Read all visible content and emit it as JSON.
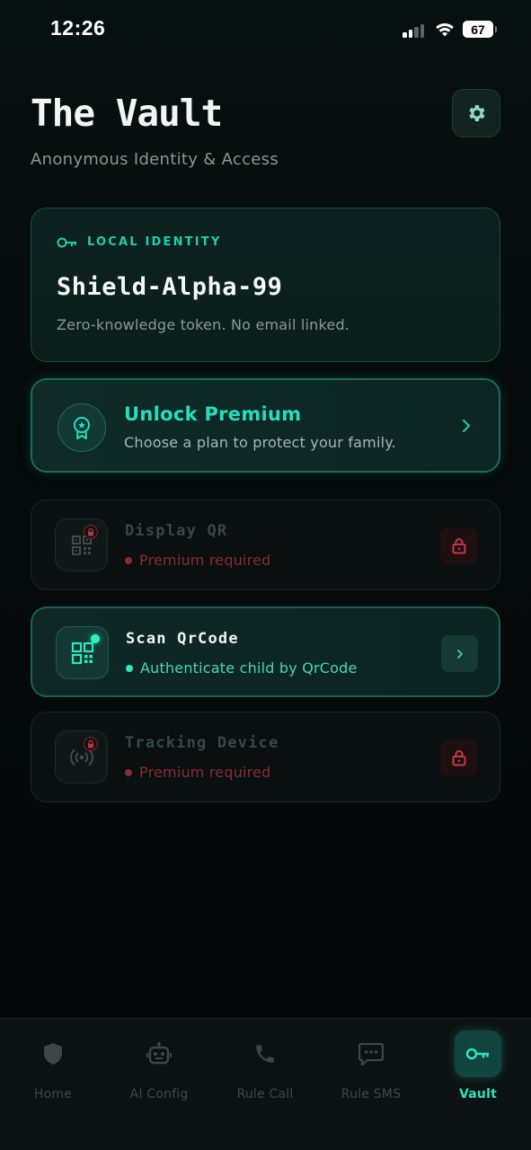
{
  "status_bar": {
    "time": "12:26",
    "battery": "67"
  },
  "header": {
    "title": "The Vault",
    "subtitle": "Anonymous Identity & Access"
  },
  "identity": {
    "label": "LOCAL IDENTITY",
    "name": "Shield-Alpha-99",
    "description": "Zero-knowledge token. No email linked."
  },
  "premium": {
    "title": "Unlock Premium",
    "description": "Choose a plan to protect your family."
  },
  "features": [
    {
      "title": "Display QR",
      "status": "Premium required",
      "icon": "qr-code-icon",
      "locked": true
    },
    {
      "title": "Scan QrCode",
      "status": "Authenticate child by QrCode",
      "icon": "qr-scan-icon",
      "locked": false
    },
    {
      "title": "Tracking Device",
      "status": "Premium required",
      "icon": "tracking-signal-icon",
      "locked": true
    }
  ],
  "nav": [
    {
      "label": "Home",
      "icon": "shield-icon"
    },
    {
      "label": "AI Config",
      "icon": "robot-icon"
    },
    {
      "label": "Rule Call",
      "icon": "phone-icon"
    },
    {
      "label": "Rule SMS",
      "icon": "message-icon"
    },
    {
      "label": "Vault",
      "icon": "key-icon",
      "active": true
    }
  ],
  "colors": {
    "accent": "#22e0bb",
    "locked": "#8b2b32",
    "background": "#050909"
  }
}
